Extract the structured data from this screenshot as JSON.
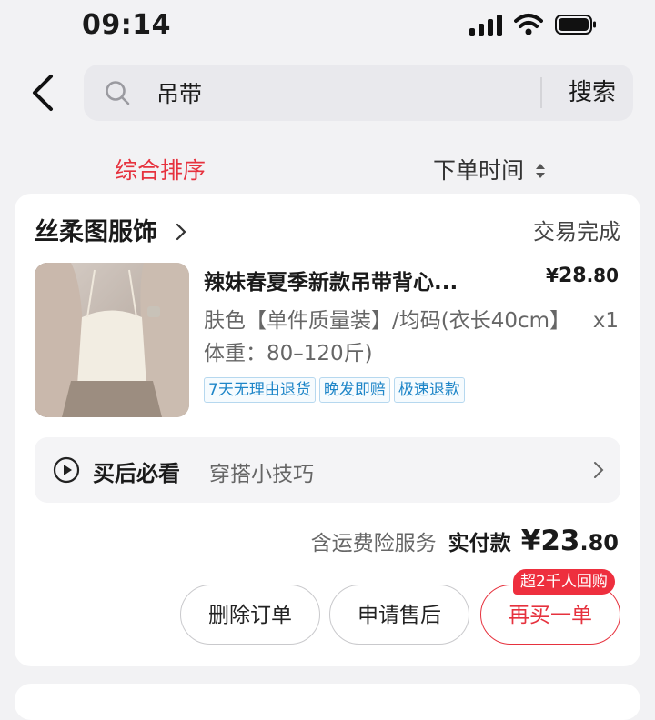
{
  "status_bar": {
    "time": "09:14"
  },
  "search": {
    "query": "吊带",
    "button_label": "搜索"
  },
  "sort": {
    "comprehensive": "综合排序",
    "order_time": "下单时间"
  },
  "order": {
    "shop_name": "丝柔图服饰",
    "status": "交易完成",
    "product": {
      "title": "辣妹春夏季新款吊带背心...",
      "price_symbol": "¥",
      "price_int": "28",
      "price_cents": ".80",
      "spec": "肤色【单件质量装】/均码(衣长40cm】体重：80–120斤)",
      "quantity": "x1"
    },
    "service_tags": [
      "7天无理由退货",
      "晚发即赔",
      "极速退款"
    ],
    "tips": {
      "title": "买后必看",
      "subtitle": "穿搭小技巧"
    },
    "payment": {
      "insurance": "含运费险服务",
      "label": "实付款",
      "symbol": "¥",
      "amount_int": "23",
      "amount_cents": ".80"
    },
    "actions": {
      "delete": "删除订单",
      "after_sale": "申请售后",
      "rebuy": "再买一单",
      "rebuy_badge": "超2千人回购"
    }
  },
  "colors": {
    "accent": "#e6323e",
    "tag_blue": "#1f86c8",
    "background": "#f2f2f4"
  },
  "icons": [
    "back-arrow-icon",
    "search-icon",
    "sort-arrows-icon",
    "chevron-right-icon",
    "play-icon"
  ]
}
